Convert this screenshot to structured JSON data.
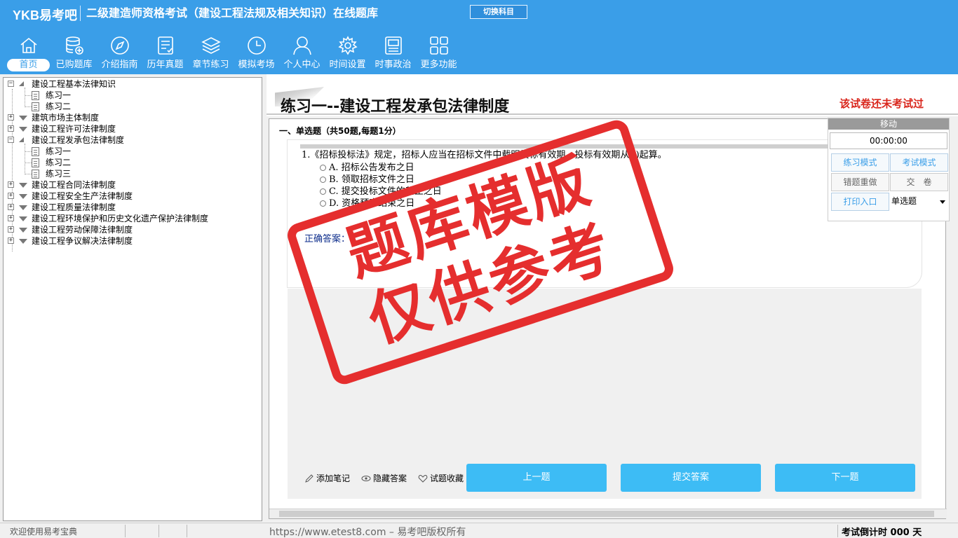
{
  "header": {
    "logo": "YKB易考吧",
    "title": "二级建造师资格考试（建设工程法规及相关知识）在线题库",
    "switch_label": "切换科目",
    "nav": [
      {
        "label": "首页",
        "icon": "home-icon"
      },
      {
        "label": "已购题库",
        "icon": "database-icon"
      },
      {
        "label": "介绍指南",
        "icon": "compass-icon"
      },
      {
        "label": "历年真题",
        "icon": "list-icon"
      },
      {
        "label": "章节练习",
        "icon": "layers-icon"
      },
      {
        "label": "模拟考场",
        "icon": "clock-icon"
      },
      {
        "label": "个人中心",
        "icon": "user-icon"
      },
      {
        "label": "时间设置",
        "icon": "gear-icon"
      },
      {
        "label": "时事政治",
        "icon": "news-icon"
      },
      {
        "label": "更多功能",
        "icon": "grid-icon"
      }
    ]
  },
  "tree": {
    "items": [
      {
        "label": "建设工程基本法律知识",
        "expanded": true
      },
      {
        "label": "练习一"
      },
      {
        "label": "练习二"
      },
      {
        "label": "建筑市场主体制度"
      },
      {
        "label": "建设工程许可法律制度"
      },
      {
        "label": "建设工程发承包法律制度",
        "expanded": true
      },
      {
        "label": "练习一"
      },
      {
        "label": "练习二"
      },
      {
        "label": "练习三"
      },
      {
        "label": "建设工程合同法律制度"
      },
      {
        "label": "建设工程安全生产法律制度"
      },
      {
        "label": "建设工程质量法律制度"
      },
      {
        "label": "建设工程环境保护和历史文化遗产保护法律制度"
      },
      {
        "label": "建设工程劳动保障法律制度"
      },
      {
        "label": "建设工程争议解决法律制度"
      }
    ]
  },
  "main": {
    "exercise_title": "练习一--建设工程发承包法律制度",
    "status": "该试卷还未考试过",
    "section": "一、单选题（共50题,每题1分）",
    "question": "1.《招标投标法》规定，招标人应当在招标文件中载明投标有效期。投标有效期从( )起算。",
    "options": [
      "A. 招标公告发布之日",
      "B. 领取招标文件之日",
      "C. 提交投标文件的截止之日",
      "D. 资格预审结束之日"
    ],
    "answer_label": "正确答案：",
    "tools": [
      "添加笔记",
      "隐藏答案",
      "试题收藏"
    ],
    "prev": "上一题",
    "submit": "提交答案",
    "next": "下一题"
  },
  "float_panel": {
    "header": "移动",
    "timer": "00:00:00",
    "practice_mode": "练习模式",
    "exam_mode": "考试模式",
    "redo_wrong": "错题重做",
    "hand_in": "交　卷",
    "print": "打印入口",
    "type_select": "单选题"
  },
  "watermark": {
    "line1": "题库模版",
    "line2": "仅供参考"
  },
  "statusbar": {
    "welcome": "欢迎使用易考宝典",
    "copyright": "https://www.etest8.com – 易考吧版权所有",
    "countdown": "考试倒计时 000 天"
  }
}
